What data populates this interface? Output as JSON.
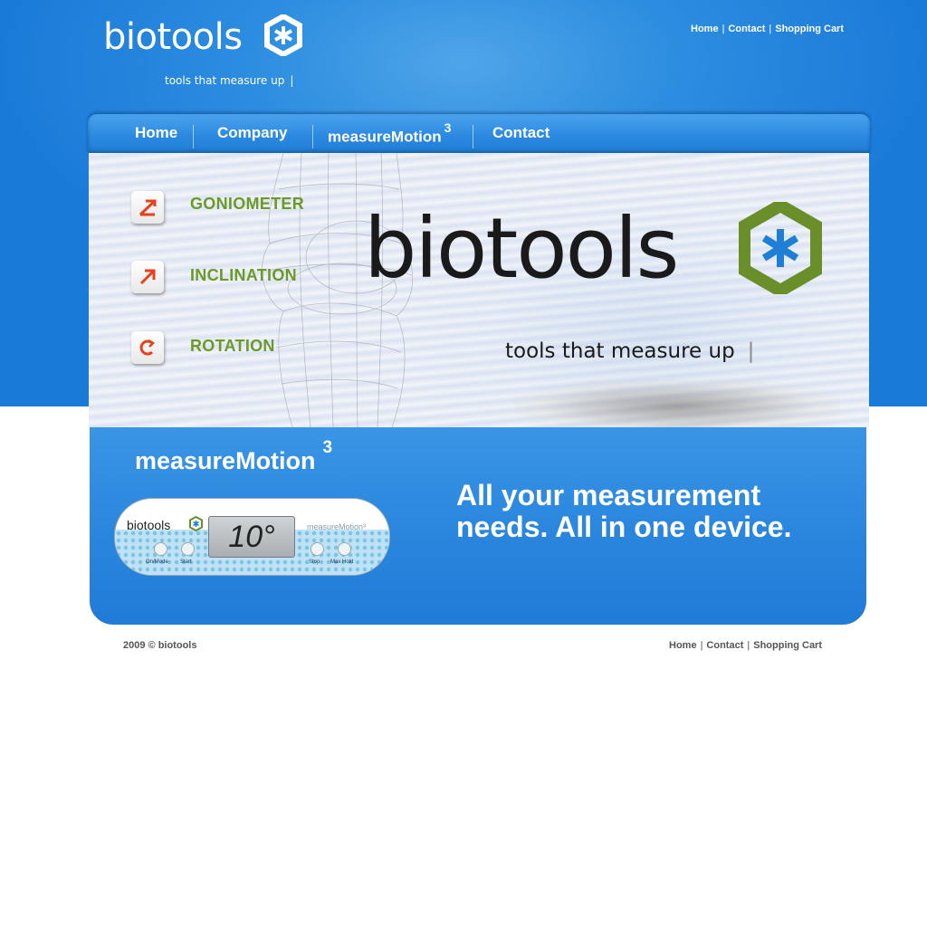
{
  "header": {
    "brand": "biotools",
    "tagline": "tools that measure up",
    "tagline_bar": "|",
    "links": [
      "Home",
      "Contact",
      "Shopping Cart"
    ],
    "separator": "|"
  },
  "nav": {
    "items": [
      {
        "label": "Home"
      },
      {
        "label": "Company"
      },
      {
        "label": "measureMotion",
        "sup": "3"
      },
      {
        "label": "Contact"
      }
    ]
  },
  "banner": {
    "features": [
      "GONIOMETER",
      "INCLINATION",
      "ROTATION"
    ],
    "brand": "biotools",
    "tagline": "tools that measure up",
    "tagline_bar": "|"
  },
  "promo": {
    "title": "measureMotion",
    "title_sup": "3",
    "headline_line1": "All your measurement",
    "headline_line2": "needs. All in one device.",
    "device": {
      "brand": "biotools",
      "reading": "10°",
      "model": "measureMotion³",
      "buttons": [
        "On/Mode",
        "Start",
        "Stop",
        "Max Hold"
      ]
    }
  },
  "footer": {
    "copyright": "2009 © biotools",
    "links": [
      "Home",
      "Contact",
      "Shopping Cart"
    ],
    "separator": "|"
  },
  "colors": {
    "primary_blue": "#2a86dd",
    "feature_green": "#6c9a2a",
    "logo_green": "#6a8f2a",
    "logo_blue": "#1e7fd4",
    "arrow_red": "#e8401a"
  }
}
